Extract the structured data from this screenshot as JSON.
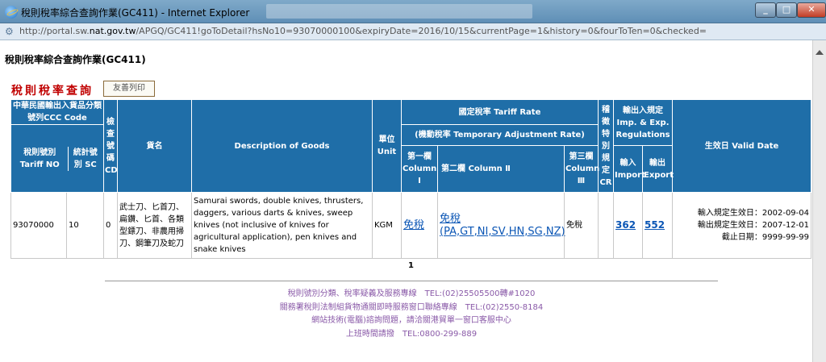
{
  "window": {
    "title": "稅則稅率綜合查詢作業(GC411) - Internet Explorer",
    "minimize": "_",
    "maximize": "□",
    "close": "✕"
  },
  "address": {
    "url_prefix": "http://portal.sw.",
    "url_domain": "nat.gov.tw",
    "url_rest": "/APGQ/GC411!goToDetail?hsNo10=93070000100&expiryDate=2016/10/15&currentPage=1&history=0&fourToTen=0&checked="
  },
  "page": {
    "heading": "稅則稅率綜合查詢作業(GC411)",
    "section_title": "稅則稅率查詢",
    "print_button": "友善列印"
  },
  "table": {
    "headers": {
      "ccc_group": "中華民國輸出入貨品分類號列CCC Code",
      "tariff_no": "稅則號別 Tariff NO",
      "stat_no": "統計號別 SC",
      "check_code": "檢查號碼 CD",
      "goods_name": "貨名",
      "description": "Description of Goods",
      "unit": "單位 Unit",
      "tariff_rate": "國定稅率 Tariff Rate",
      "temp_adjust": "(機動稅率 Temporary Adjustment Rate)",
      "col1": "第一欄 Column Ⅰ",
      "col2": "第二欄 Column Ⅱ",
      "col3": "第三欄 Column Ⅲ",
      "special": "稽徵特別規定 CR",
      "regulations": "輸出入規定 Imp. & Exp. Regulations",
      "import": "輸入 Import",
      "export": "輸出 Export",
      "valid_date": "生效日 Valid Date"
    },
    "row": {
      "tariff_no": "93070000",
      "stat_no": "10",
      "check_code": "0",
      "goods_name": "武士刀、匕首刀、扁鑽、匕首、各類型鏢刀、非農用掃刀、鋼筆刀及蛇刀",
      "description": "Samurai swords, double knives, thrusters, daggers, various darts & knives, sweep knives (not inclusive of knives for agricultural application), pen knives and snake knives",
      "unit": "KGM",
      "col1": "免稅",
      "col2": "免稅 (PA,GT,NI,SV,HN,SG,NZ)",
      "col3": "免稅",
      "special": "",
      "import": "362",
      "export": "552",
      "valid_import": "輸入規定生效日：2002-09-04",
      "valid_export": "輸出規定生效日：2007-12-01",
      "valid_end": "截止日期：9999-99-99"
    }
  },
  "pager": {
    "current": "1"
  },
  "footer": {
    "line1": "稅則號別分類、稅率疑義及服務專線　TEL:(02)25505500轉#1020",
    "line2": "關務署稅則法制組貨物通關即時服務窗口聯絡專線　TEL:(02)2550-8184",
    "line3": "網站技術(電腦)諮詢問題，請洽關港貿單一窗口客服中心",
    "line4": "上班時間請撥　TEL:0800-299-889"
  }
}
